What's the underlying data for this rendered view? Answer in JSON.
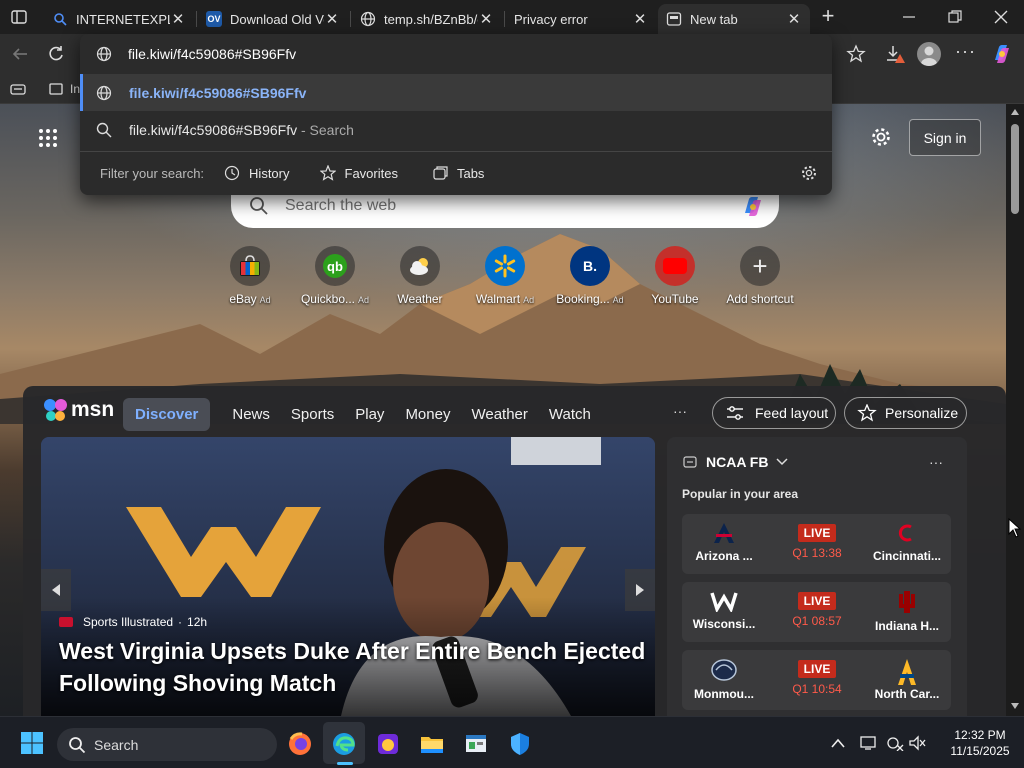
{
  "tabs": [
    {
      "title": "INTERNETEXPLORER"
    },
    {
      "title": "Download Old Ve",
      "favicon_text": "OV"
    },
    {
      "title": "temp.sh/BZnBb/c"
    },
    {
      "title": "Privacy error"
    },
    {
      "title": "New tab"
    }
  ],
  "address": {
    "value": "file.kiwi/f4c59086#SB96Ffv"
  },
  "favbar": {
    "partial_label": "In"
  },
  "omnibox": {
    "suggestion_url": "file.kiwi/f4c59086#SB96Ffv",
    "search_query": "file.kiwi/f4c59086#SB96Ffv",
    "search_suffix": " - Search",
    "filter_label": "Filter your search:",
    "filters": [
      "History",
      "Favorites",
      "Tabs"
    ]
  },
  "header": {
    "sign_in": "Sign in"
  },
  "search": {
    "placeholder": "Search the web"
  },
  "shortcuts": [
    {
      "label": "eBay",
      "ad": "Ad"
    },
    {
      "label": "Quickbo...",
      "ad": "Ad"
    },
    {
      "label": "Weather",
      "ad": ""
    },
    {
      "label": "Walmart",
      "ad": "Ad"
    },
    {
      "label": "Booking...",
      "ad": "Ad",
      "icon_text": "B."
    },
    {
      "label": "YouTube",
      "ad": ""
    },
    {
      "label": "Add shortcut",
      "ad": ""
    }
  ],
  "msn": {
    "logo": "msn",
    "nav": [
      "Discover",
      "News",
      "Sports",
      "Play",
      "Money",
      "Weather",
      "Watch"
    ],
    "more": "···",
    "feed_layout": "Feed layout",
    "personalize": "Personalize"
  },
  "hero": {
    "source": "Sports Illustrated",
    "age": "12h",
    "headline_1": "West Virginia Upsets Duke After Entire Bench Ejected",
    "headline_2": "Following Shoving Match"
  },
  "ncaa": {
    "title": "NCAA FB",
    "subtitle": "Popular in your area",
    "more": "···",
    "games": [
      {
        "home": "Arizona ...",
        "away": "Cincinnati...",
        "status": "LIVE",
        "clock": "Q1 13:38"
      },
      {
        "home": "Wisconsi...",
        "away": "Indiana H...",
        "status": "LIVE",
        "clock": "Q1 08:57"
      },
      {
        "home": "Monmou...",
        "away": "North Car...",
        "status": "LIVE",
        "clock": "Q1 10:54"
      }
    ]
  },
  "taskbar": {
    "search": "Search",
    "time": "12:32 PM",
    "date": "11/15/2025"
  },
  "colors": {
    "live": "#c42b1c",
    "accent": "#4f8ef7",
    "suggest_link": "#8ab4f8"
  }
}
